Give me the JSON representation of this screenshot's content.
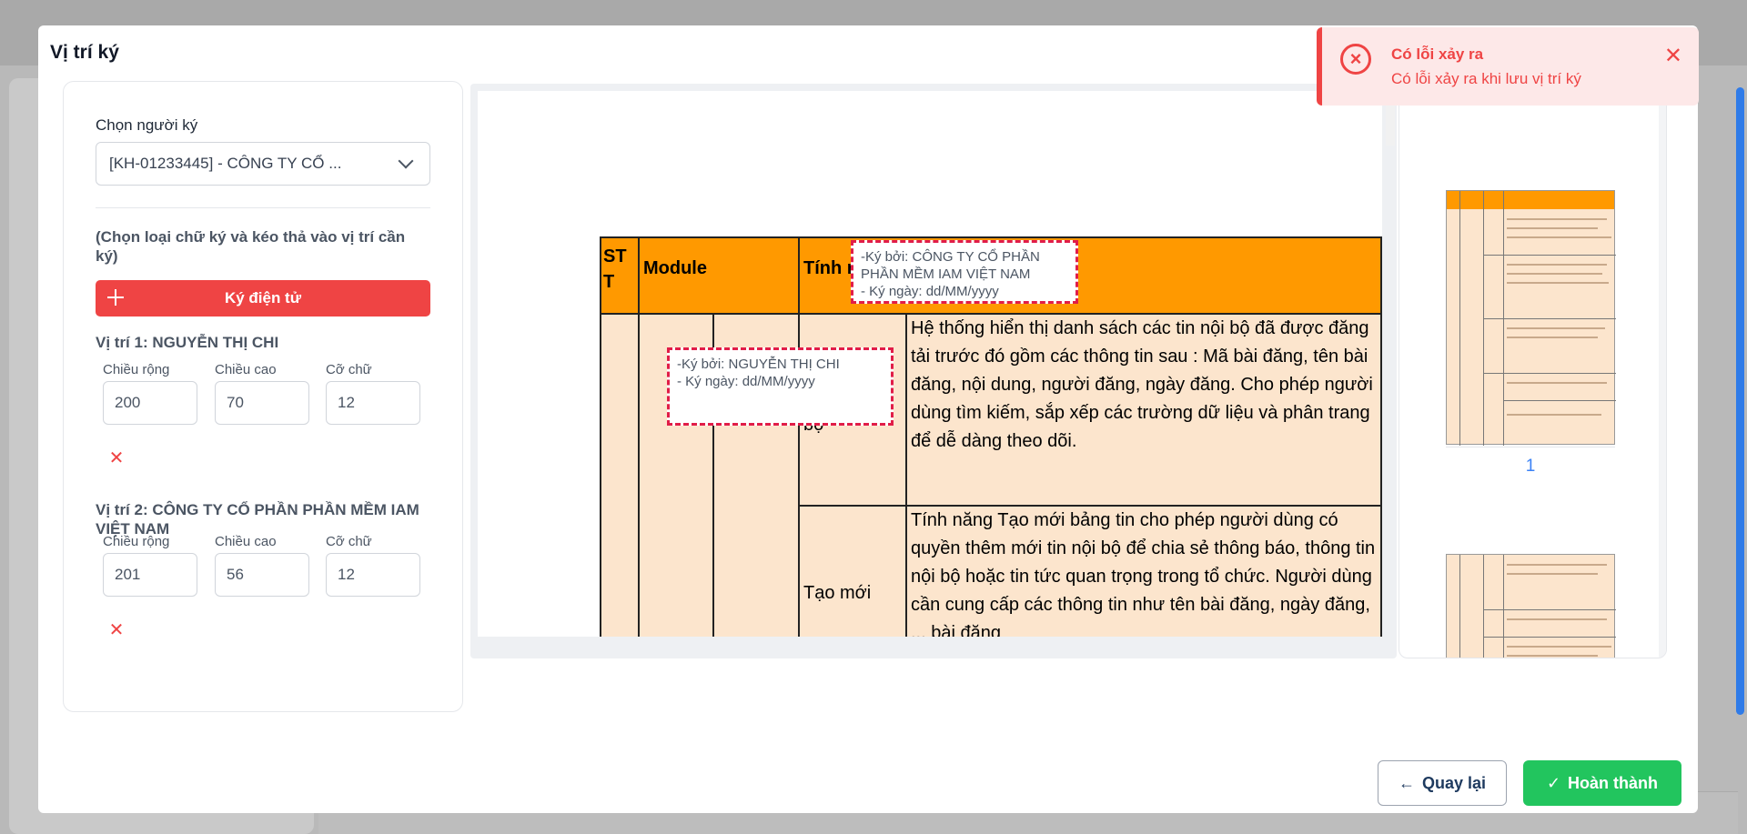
{
  "modal": {
    "title": "Vị trí ký"
  },
  "left_panel": {
    "signer_label": "Chọn người ký",
    "signer_value": "[KH-01233445] - CÔNG TY CỔ ...",
    "hint": "(Chọn loại chữ ký và kéo thả vào vị trí cần ký)",
    "sign_button": "Ký điện tử",
    "positions": [
      {
        "title": "Vị trí 1: NGUYỄN THỊ CHI",
        "width_label": "Chiều rộng",
        "height_label": "Chiều cao",
        "font_label": "Cỡ chữ",
        "width": "200",
        "height": "70",
        "font_size": "12"
      },
      {
        "title": "Vị trí 2: CÔNG TY CỔ PHẦN PHẦN MỀM IAM VIỆT NAM",
        "width_label": "Chiều rộng",
        "height_label": "Chiều cao",
        "font_label": "Cỡ chữ",
        "width": "201",
        "height": "56",
        "font_size": "12"
      }
    ]
  },
  "document": {
    "header": {
      "stt": "ST T",
      "module": "Module",
      "feature": "Tính n"
    },
    "row1_feature": "bộ",
    "row1_desc": "Hệ thống hiển thị danh sách các tin nội bộ đã được đăng tải trước đó gồm các thông tin sau : Mã bài đăng, tên bài đăng, nội dung, người đăng, ngày đăng. Cho phép người dùng tìm kiếm, sắp xếp các trường dữ liệu và phân trang để dễ dàng theo dõi.",
    "row2_feature": "Tạo mới",
    "row2_desc": "Tính năng Tạo mới bảng tin cho phép người dùng có quyền thêm mới tin nội bộ để chia sẻ thông báo, thông tin nội bộ hoặc tin tức quan trọng trong tổ chức. Người dùng cần cung cấp các thông tin như tên bài đăng, ngày đăng, ... bài đăng",
    "sig1": {
      "line1": "-Ký bởi: NGUYỄN THỊ CHI",
      "line2": "- Ký ngày: dd/MM/yyyy"
    },
    "sig2": {
      "line1": "-Ký bởi: CÔNG TY CỔ PHẦN PHẦN MỀM IAM VIỆT NAM",
      "line2": "- Ký ngày: dd/MM/yyyy"
    }
  },
  "thumbnails": {
    "page_number": "1"
  },
  "footer": {
    "back_label": "Quay lại",
    "done_label": "Hoàn thành"
  },
  "toast": {
    "title": "Có lỗi xảy ra",
    "message": "Có lỗi xảy ra khi lưu vị trí ký"
  },
  "colors": {
    "primary_red": "#ef4444",
    "success_green": "#22c55e",
    "table_header_orange": "#ff9900",
    "table_cell_peach": "#fce5cd",
    "link_blue": "#3b82f6"
  }
}
